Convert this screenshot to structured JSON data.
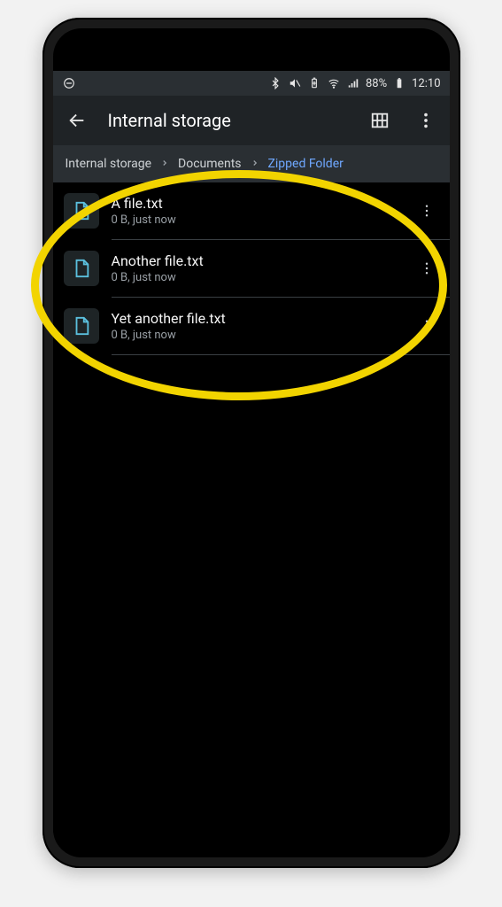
{
  "statusbar": {
    "battery_text": "88%",
    "clock": "12:10"
  },
  "header": {
    "title": "Internal storage"
  },
  "breadcrumbs": {
    "items": [
      {
        "label": "Internal storage"
      },
      {
        "label": "Documents"
      },
      {
        "label": "Zipped Folder",
        "active": true
      }
    ]
  },
  "files": [
    {
      "name": "A file.txt",
      "meta": "0 B, just now"
    },
    {
      "name": "Another file.txt",
      "meta": "0 B, just now"
    },
    {
      "name": "Yet another file.txt",
      "meta": "0 B, just now"
    }
  ]
}
